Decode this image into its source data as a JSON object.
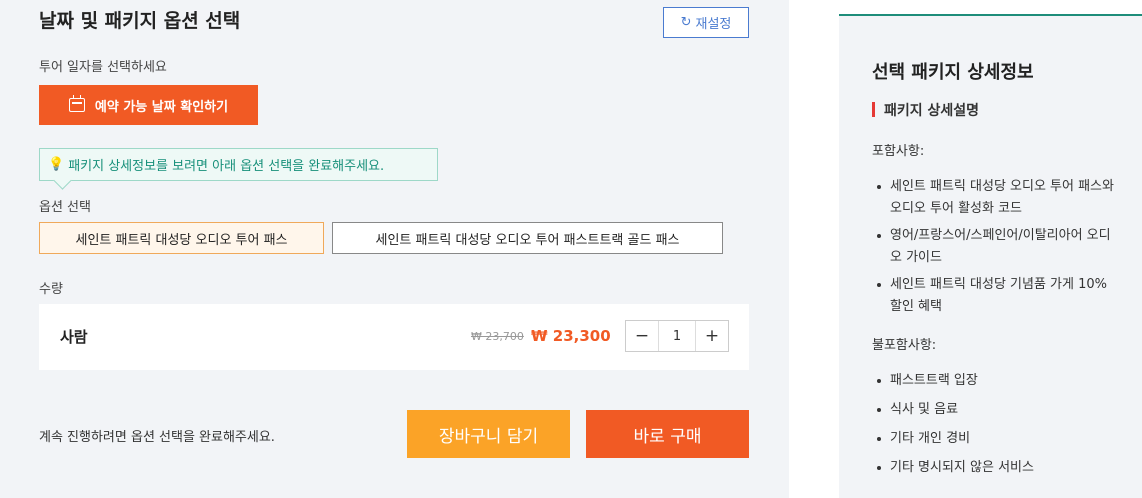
{
  "header": {
    "title": "날짜 및 패키지 옵션 선택",
    "reset_label": "재설정"
  },
  "date": {
    "label": "투어 일자를 선택하세요",
    "button_label": "예약 가능 날짜 확인하기"
  },
  "tooltip": {
    "text": "패키지 상세정보를 보려면 아래 옵션 선택을 완료해주세요."
  },
  "options": {
    "label": "옵션 선택",
    "items": [
      {
        "label": "세인트 패트릭 대성당 오디오 투어 패스",
        "selected": true
      },
      {
        "label": "세인트 패트릭 대성당 오디오 투어 패스트트랙 골드 패스",
        "selected": false
      }
    ]
  },
  "quantity": {
    "label": "수량",
    "person_label": "사람",
    "original_price": "₩ 23,700",
    "sale_price": "₩ 23,300",
    "value": "1",
    "minus": "−",
    "plus": "+"
  },
  "footer": {
    "message": "계속 진행하려면 옵션 선택을 완료해주세요.",
    "cart_label": "장바구니 담기",
    "buy_label": "바로 구매"
  },
  "detail": {
    "title": "선택 패키지 상세정보",
    "subtitle": "패키지 상세설명",
    "included_label": "포함사항:",
    "included": [
      "세인트 패트릭 대성당 오디오 투어 패스와 오디오 투어 활성화 코드",
      "영어/프랑스어/스페인어/이탈리아어 오디오 가이드",
      "세인트 패트릭 대성당 기념품 가게 10% 할인 혜택"
    ],
    "excluded_label": "불포함사항:",
    "excluded": [
      "패스트트랙 입장",
      "식사 및 음료",
      "기타 개인 경비",
      "기타 명시되지 않은 서비스"
    ]
  },
  "colors": {
    "primary_orange": "#f15a24",
    "cart_orange": "#fba327",
    "accent_teal": "#1e8d7a",
    "reset_blue": "#4a7bd0"
  }
}
